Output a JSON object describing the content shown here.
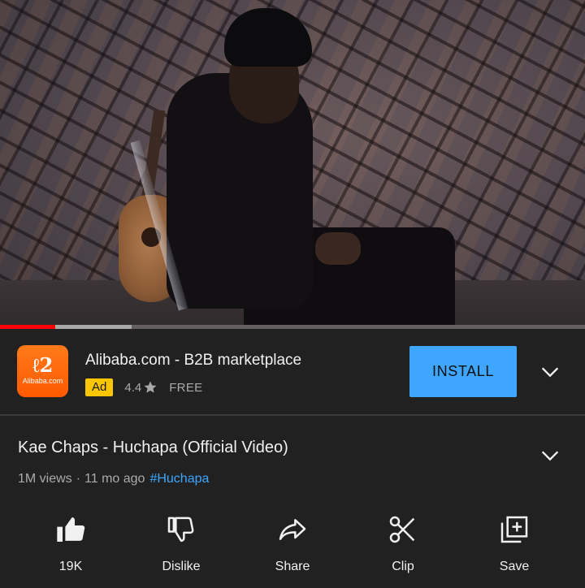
{
  "ad": {
    "title": "Alibaba.com - B2B marketplace",
    "badge": "Ad",
    "rating": "4.4",
    "price": "FREE",
    "install_label": "INSTALL",
    "logo_glyph": "ℓ2",
    "logo_text": "Alibaba.com",
    "logo_color": "#ff6a00",
    "install_color": "#3ea6ff"
  },
  "player": {
    "progress_played_percent": 9.5,
    "progress_buffered_percent": 22.5,
    "progress_color": "#ff0000"
  },
  "video": {
    "title": "Kae Chaps - Huchapa (Official Video)",
    "views": "1M views",
    "separator": "·",
    "age": "11 mo ago",
    "hashtag": "#Huchapa",
    "hashtag_color": "#3ea6ff"
  },
  "actions": [
    {
      "label": "19K",
      "icon": "thumbs-up-icon"
    },
    {
      "label": "Dislike",
      "icon": "thumbs-down-icon"
    },
    {
      "label": "Share",
      "icon": "share-icon"
    },
    {
      "label": "Clip",
      "icon": "scissors-icon"
    },
    {
      "label": "Save",
      "icon": "add-to-playlist-icon"
    }
  ]
}
